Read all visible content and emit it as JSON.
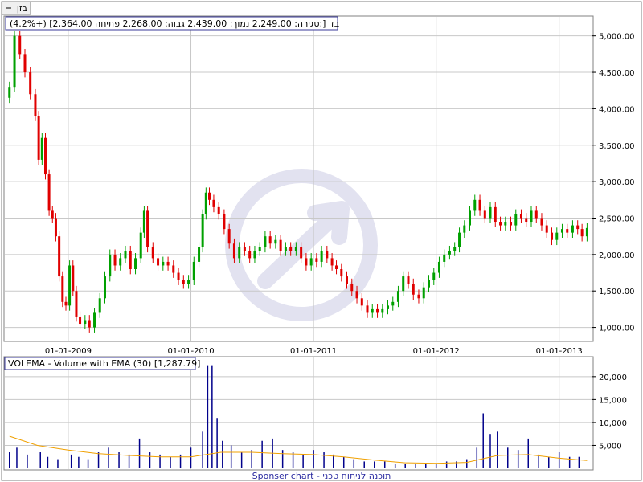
{
  "instrument_tag": "בזן",
  "ohlc_line": {
    "name": "בזן",
    "open_label": "פתיחה:",
    "open": "2,268.00",
    "high_label": "גבוה:",
    "high": "2,439.00",
    "low_label": "נמוך:",
    "low": "2,249.00",
    "close_label": "סגירה:",
    "close": "2,364.00",
    "change": "(4.2%+)"
  },
  "volume_header": "VOLEMA - Volume with EMA (30) [1,287.79]",
  "footer": "Sponser chart - תוכנה לניתוח טכני",
  "colors": {
    "up": "#00A000",
    "down": "#E00000",
    "volume": "#00008B",
    "ema": "#F0A000",
    "grid": "#C8C8C8",
    "watermark": "#E2E2F0"
  },
  "chart_data": [
    {
      "type": "candlestick",
      "x_tick_labels": [
        "01-01-2009",
        "01-01-2010",
        "01-01-2011",
        "01-01-2012",
        "01-01-2013"
      ],
      "x_range": [
        "2008-07-01",
        "2013-04-05"
      ],
      "y_tick_labels": [
        "1,000.00",
        "1,500.00",
        "2,000.00",
        "2,500.00",
        "3,000.00",
        "3,500.00",
        "4,000.00",
        "4,500.00",
        "5,000.00"
      ],
      "ylim": [
        830,
        5250
      ],
      "grid": true,
      "close_series": [
        [
          "2008-07-10",
          4300
        ],
        [
          "2008-07-25",
          5000
        ],
        [
          "2008-08-10",
          4750
        ],
        [
          "2008-08-25",
          4500
        ],
        [
          "2008-09-10",
          4200
        ],
        [
          "2008-09-25",
          3900
        ],
        [
          "2008-10-05",
          3300
        ],
        [
          "2008-10-15",
          3600
        ],
        [
          "2008-10-25",
          3100
        ],
        [
          "2008-11-05",
          2600
        ],
        [
          "2008-11-15",
          2500
        ],
        [
          "2008-11-25",
          2250
        ],
        [
          "2008-12-05",
          1700
        ],
        [
          "2008-12-15",
          1350
        ],
        [
          "2008-12-25",
          1300
        ],
        [
          "2009-01-05",
          1850
        ],
        [
          "2009-01-15",
          1500
        ],
        [
          "2009-01-25",
          1150
        ],
        [
          "2009-02-05",
          1050
        ],
        [
          "2009-02-20",
          1100
        ],
        [
          "2009-03-05",
          1000
        ],
        [
          "2009-03-20",
          1200
        ],
        [
          "2009-04-05",
          1400
        ],
        [
          "2009-04-20",
          1700
        ],
        [
          "2009-05-05",
          2000
        ],
        [
          "2009-05-20",
          1850
        ],
        [
          "2009-06-05",
          1950
        ],
        [
          "2009-06-20",
          2050
        ],
        [
          "2009-07-05",
          1800
        ],
        [
          "2009-07-20",
          1950
        ],
        [
          "2009-08-05",
          2300
        ],
        [
          "2009-08-15",
          2600
        ],
        [
          "2009-08-25",
          2100
        ],
        [
          "2009-09-10",
          1950
        ],
        [
          "2009-09-25",
          1850
        ],
        [
          "2009-10-10",
          1900
        ],
        [
          "2009-10-25",
          1850
        ],
        [
          "2009-11-10",
          1750
        ],
        [
          "2009-11-25",
          1650
        ],
        [
          "2009-12-10",
          1600
        ],
        [
          "2009-12-25",
          1650
        ],
        [
          "2010-01-10",
          1900
        ],
        [
          "2010-01-25",
          2100
        ],
        [
          "2010-02-05",
          2550
        ],
        [
          "2010-02-15",
          2850
        ],
        [
          "2010-02-25",
          2750
        ],
        [
          "2010-03-10",
          2650
        ],
        [
          "2010-03-25",
          2550
        ],
        [
          "2010-04-10",
          2350
        ],
        [
          "2010-04-25",
          2150
        ],
        [
          "2010-05-10",
          1950
        ],
        [
          "2010-05-25",
          2100
        ],
        [
          "2010-06-10",
          2050
        ],
        [
          "2010-06-25",
          1950
        ],
        [
          "2010-07-10",
          2050
        ],
        [
          "2010-07-25",
          2100
        ],
        [
          "2010-08-10",
          2250
        ],
        [
          "2010-08-25",
          2150
        ],
        [
          "2010-09-10",
          2200
        ],
        [
          "2010-09-25",
          2050
        ],
        [
          "2010-10-10",
          2100
        ],
        [
          "2010-10-25",
          2050
        ],
        [
          "2010-11-10",
          2100
        ],
        [
          "2010-11-25",
          1950
        ],
        [
          "2010-12-10",
          1850
        ],
        [
          "2010-12-25",
          1950
        ],
        [
          "2011-01-10",
          1900
        ],
        [
          "2011-01-25",
          2050
        ],
        [
          "2011-02-10",
          1950
        ],
        [
          "2011-02-25",
          1850
        ],
        [
          "2011-03-10",
          1800
        ],
        [
          "2011-03-25",
          1700
        ],
        [
          "2011-04-10",
          1600
        ],
        [
          "2011-04-25",
          1500
        ],
        [
          "2011-05-10",
          1400
        ],
        [
          "2011-05-25",
          1300
        ],
        [
          "2011-06-10",
          1200
        ],
        [
          "2011-06-25",
          1250
        ],
        [
          "2011-07-10",
          1200
        ],
        [
          "2011-07-25",
          1250
        ],
        [
          "2011-08-10",
          1300
        ],
        [
          "2011-08-25",
          1350
        ],
        [
          "2011-09-10",
          1500
        ],
        [
          "2011-09-25",
          1700
        ],
        [
          "2011-10-10",
          1600
        ],
        [
          "2011-10-25",
          1450
        ],
        [
          "2011-11-10",
          1400
        ],
        [
          "2011-11-25",
          1550
        ],
        [
          "2011-12-10",
          1650
        ],
        [
          "2011-12-25",
          1750
        ],
        [
          "2012-01-10",
          1900
        ],
        [
          "2012-01-25",
          2000
        ],
        [
          "2012-02-10",
          2050
        ],
        [
          "2012-02-25",
          2100
        ],
        [
          "2012-03-10",
          2300
        ],
        [
          "2012-03-25",
          2400
        ],
        [
          "2012-04-10",
          2600
        ],
        [
          "2012-04-25",
          2750
        ],
        [
          "2012-05-10",
          2600
        ],
        [
          "2012-05-25",
          2500
        ],
        [
          "2012-06-10",
          2650
        ],
        [
          "2012-06-25",
          2450
        ],
        [
          "2012-07-10",
          2400
        ],
        [
          "2012-07-25",
          2450
        ],
        [
          "2012-08-10",
          2400
        ],
        [
          "2012-08-25",
          2550
        ],
        [
          "2012-09-10",
          2500
        ],
        [
          "2012-09-25",
          2450
        ],
        [
          "2012-10-10",
          2600
        ],
        [
          "2012-10-25",
          2500
        ],
        [
          "2012-11-10",
          2400
        ],
        [
          "2012-11-25",
          2300
        ],
        [
          "2012-12-10",
          2200
        ],
        [
          "2012-12-25",
          2300
        ],
        [
          "2013-01-10",
          2350
        ],
        [
          "2013-01-25",
          2300
        ],
        [
          "2013-02-10",
          2400
        ],
        [
          "2013-02-25",
          2350
        ],
        [
          "2013-03-10",
          2250
        ],
        [
          "2013-03-25",
          2364
        ]
      ]
    },
    {
      "type": "bar",
      "y_tick_labels": [
        "5,000",
        "10,000",
        "15,000",
        "20,000"
      ],
      "ylim": [
        0,
        24000
      ],
      "volume_series": [
        [
          "2008-07-10",
          3500
        ],
        [
          "2008-08-01",
          4500
        ],
        [
          "2008-09-01",
          3000
        ],
        [
          "2008-10-10",
          3500
        ],
        [
          "2008-11-01",
          2500
        ],
        [
          "2008-12-01",
          2000
        ],
        [
          "2009-01-10",
          3000
        ],
        [
          "2009-02-01",
          2500
        ],
        [
          "2009-03-01",
          2000
        ],
        [
          "2009-04-01",
          3500
        ],
        [
          "2009-05-01",
          4500
        ],
        [
          "2009-06-01",
          3500
        ],
        [
          "2009-07-01",
          3000
        ],
        [
          "2009-08-01",
          6500
        ],
        [
          "2009-09-01",
          3500
        ],
        [
          "2009-10-01",
          3000
        ],
        [
          "2009-11-01",
          2500
        ],
        [
          "2009-12-01",
          3000
        ],
        [
          "2010-01-01",
          4500
        ],
        [
          "2010-02-05",
          8000
        ],
        [
          "2010-02-20",
          22500
        ],
        [
          "2010-03-05",
          22500
        ],
        [
          "2010-03-20",
          11000
        ],
        [
          "2010-04-05",
          6000
        ],
        [
          "2010-05-01",
          5000
        ],
        [
          "2010-06-01",
          3500
        ],
        [
          "2010-07-01",
          4000
        ],
        [
          "2010-08-01",
          6000
        ],
        [
          "2010-09-01",
          6500
        ],
        [
          "2010-10-01",
          4000
        ],
        [
          "2010-11-01",
          3500
        ],
        [
          "2010-12-01",
          3000
        ],
        [
          "2011-01-01",
          4000
        ],
        [
          "2011-02-01",
          3500
        ],
        [
          "2011-03-01",
          3000
        ],
        [
          "2011-04-01",
          2500
        ],
        [
          "2011-05-01",
          2000
        ],
        [
          "2011-06-01",
          1500
        ],
        [
          "2011-07-01",
          1500
        ],
        [
          "2011-08-01",
          1500
        ],
        [
          "2011-09-01",
          1000
        ],
        [
          "2011-10-01",
          1000
        ],
        [
          "2011-11-01",
          1000
        ],
        [
          "2011-12-01",
          1000
        ],
        [
          "2012-01-01",
          1000
        ],
        [
          "2012-02-01",
          1500
        ],
        [
          "2012-03-01",
          1500
        ],
        [
          "2012-04-01",
          2000
        ],
        [
          "2012-05-01",
          4500
        ],
        [
          "2012-05-20",
          12000
        ],
        [
          "2012-06-10",
          7500
        ],
        [
          "2012-07-01",
          8000
        ],
        [
          "2012-08-01",
          4500
        ],
        [
          "2012-09-01",
          4000
        ],
        [
          "2012-10-01",
          6500
        ],
        [
          "2012-11-01",
          3000
        ],
        [
          "2012-12-01",
          2500
        ],
        [
          "2013-01-01",
          3500
        ],
        [
          "2013-02-01",
          2500
        ],
        [
          "2013-03-01",
          2500
        ]
      ],
      "ema_series": [
        [
          "2008-07-10",
          7000
        ],
        [
          "2008-10-01",
          5000
        ],
        [
          "2009-01-01",
          4000
        ],
        [
          "2009-04-01",
          3200
        ],
        [
          "2009-07-01",
          2800
        ],
        [
          "2009-10-01",
          2500
        ],
        [
          "2010-01-01",
          2500
        ],
        [
          "2010-04-01",
          3500
        ],
        [
          "2010-07-01",
          3500
        ],
        [
          "2010-10-01",
          3200
        ],
        [
          "2011-01-01",
          3000
        ],
        [
          "2011-04-01",
          2500
        ],
        [
          "2011-07-01",
          1800
        ],
        [
          "2011-10-01",
          1200
        ],
        [
          "2012-01-01",
          1100
        ],
        [
          "2012-04-01",
          1300
        ],
        [
          "2012-07-01",
          2800
        ],
        [
          "2012-10-01",
          3000
        ],
        [
          "2013-01-01",
          2200
        ],
        [
          "2013-03-25",
          1700
        ]
      ]
    }
  ]
}
